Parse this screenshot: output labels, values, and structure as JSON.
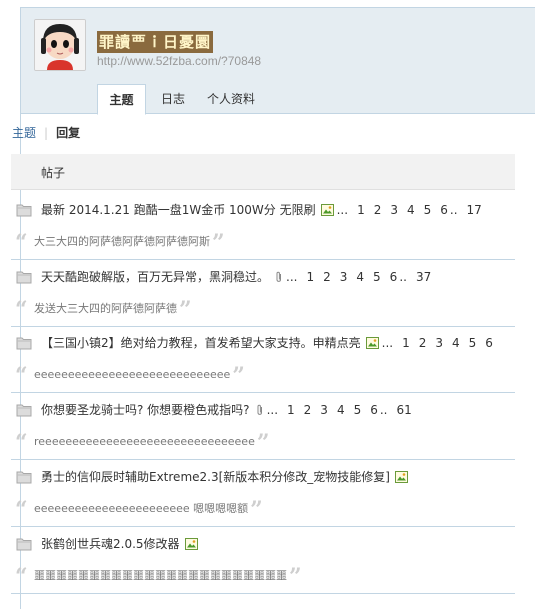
{
  "profile": {
    "username": "罪讀覀ｉ日憂圜",
    "url": "http://www.52fzba.com/?70848"
  },
  "tabs": [
    {
      "label": "主题",
      "active": true
    },
    {
      "label": "日志",
      "active": false
    },
    {
      "label": "个人资料",
      "active": false
    }
  ],
  "subnav": {
    "topic": "主题",
    "separator": "|",
    "reply": "回复"
  },
  "list_header": "帖子",
  "threads": [
    {
      "title": "最新 2014.1.21 跑酷一盘1W金币 100W分 无限刷",
      "has_image": true,
      "has_attachment": false,
      "pages": [
        "1",
        "2",
        "3",
        "4",
        "5",
        "6"
      ],
      "ellipsis": "...",
      "mid_ellipsis": "..",
      "last_page": "17",
      "reply": "大三大四的阿萨德阿萨德阿萨德阿斯"
    },
    {
      "title": "天天酷跑破解版，百万无异常，黑洞稳过。",
      "has_image": false,
      "has_attachment": true,
      "pages": [
        "1",
        "2",
        "3",
        "4",
        "5",
        "6"
      ],
      "ellipsis": "...",
      "mid_ellipsis": "..",
      "last_page": "37",
      "reply": "发送大三大四的阿萨德阿萨德"
    },
    {
      "title": "【三国小镇2】绝对给力教程，首发希望大家支持。申精点亮",
      "has_image": true,
      "has_attachment": false,
      "pages": [
        "1",
        "2",
        "3",
        "4",
        "5",
        "6"
      ],
      "ellipsis": "...",
      "mid_ellipsis": "",
      "last_page": "",
      "reply": "eeeeeeeeeeeeeeeeeeeeeeeeeeeee"
    },
    {
      "title": "你想要圣龙骑士吗? 你想要橙色戒指吗?",
      "has_image": false,
      "has_attachment": true,
      "pages": [
        "1",
        "2",
        "3",
        "4",
        "5",
        "6"
      ],
      "ellipsis": "...",
      "mid_ellipsis": "..",
      "last_page": "61",
      "reply": "reeeeeeeeeeeeeeeeeeeeeeeeeeeeeeee"
    },
    {
      "title": "勇士的信仰辰时辅助Extreme2.3[新版本积分修改_宠物技能修复]",
      "has_image": true,
      "has_attachment": false,
      "pages": [],
      "ellipsis": "",
      "mid_ellipsis": "",
      "last_page": "",
      "reply": "eeeeeeeeeeeeeeeeeeeeeee 嗯嗯嗯嗯额"
    },
    {
      "title": "张鹤创世兵魂2.0.5修改器",
      "has_image": true,
      "has_attachment": false,
      "pages": [],
      "ellipsis": "",
      "mid_ellipsis": "",
      "last_page": "",
      "reply": "噩噩噩噩噩噩噩噩噩噩噩噩噩噩噩噩噩噩噩噩噩噩噩"
    }
  ],
  "icons": {
    "folder": "folder-icon",
    "image": "image-icon",
    "attachment": "paperclip-icon",
    "quote_open": "“",
    "quote_close": "”"
  },
  "colors": {
    "header_bg": "#e5edf2",
    "border": "#c2d5e3",
    "link": "#336699",
    "quote": "#cfcfcf"
  }
}
